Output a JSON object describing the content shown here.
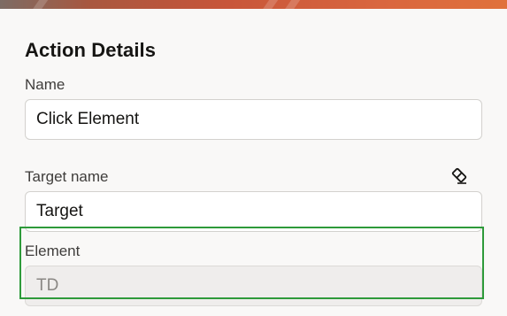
{
  "colors": {
    "highlight": "#2e9a3a",
    "banner_accent": "#d9663f"
  },
  "section": {
    "title": "Action Details"
  },
  "fields": {
    "name": {
      "label": "Name",
      "value": "Click Element"
    },
    "target_name": {
      "label": "Target name",
      "value": "Target",
      "clear_icon": "eraser-icon"
    },
    "element": {
      "label": "Element",
      "value": "TD",
      "disabled": true
    }
  }
}
